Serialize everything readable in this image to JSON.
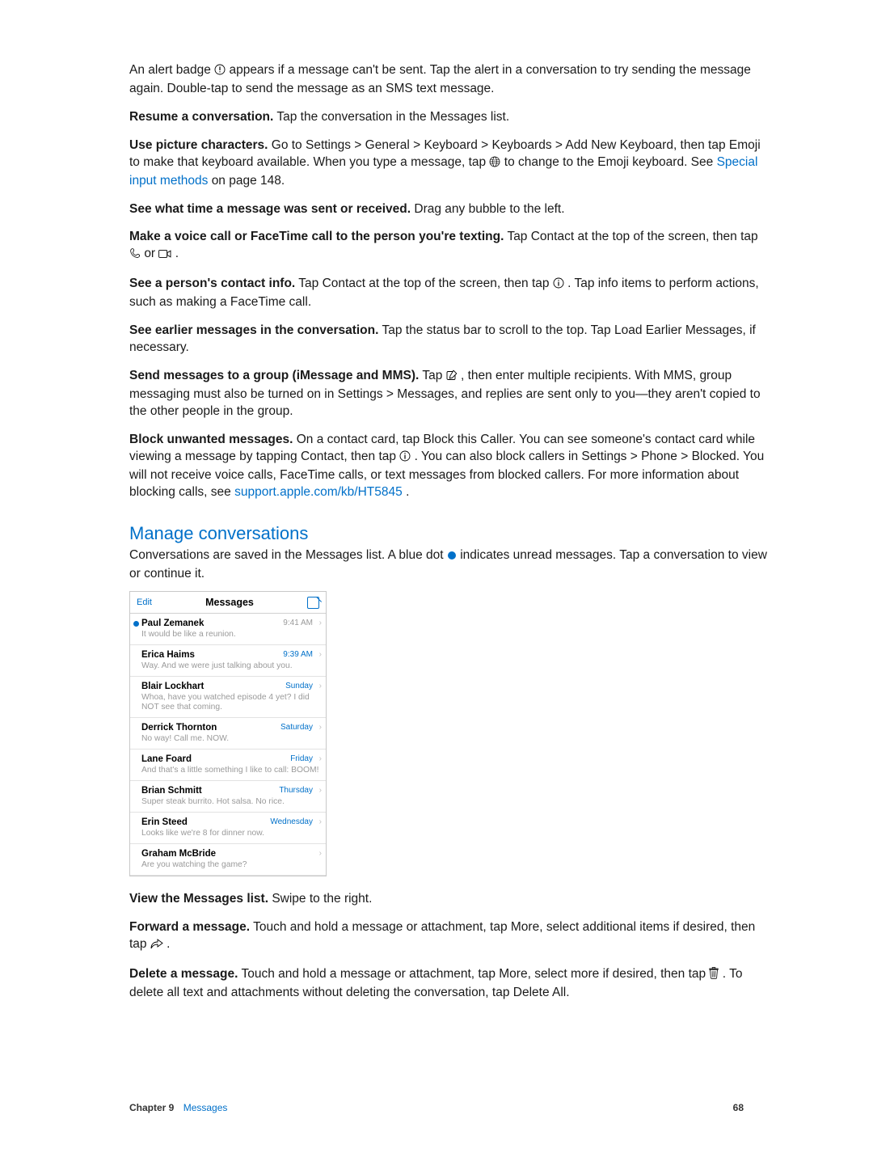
{
  "paragraphs": {
    "p1a": "An alert badge ",
    "p1b": " appears if a message can't be sent. Tap the alert in a conversation to try sending the message again. Double-tap to send the message as an SMS text message.",
    "p2_strong": "Resume a conversation.",
    "p2_rest": " Tap the conversation in the Messages list.",
    "p3_strong": "Use picture characters.",
    "p3a": " Go to Settings > General > Keyboard > Keyboards > Add New Keyboard, then tap Emoji to make that keyboard available. When you type a message, tap ",
    "p3b": " to change to the Emoji keyboard. See ",
    "p3_link": "Special input methods",
    "p3c": " on page 148.",
    "p4_strong": "See what time a message was sent or received.",
    "p4_rest": " Drag any bubble to the left.",
    "p5_strong": "Make a voice call or FaceTime call to the person you're texting.",
    "p5a": " Tap Contact at the top of the screen, then tap ",
    "p5b": " or ",
    "p5c": ".",
    "p6_strong": "See a person's contact info.",
    "p6a": " Tap Contact at the top of the screen, then tap ",
    "p6b": ". Tap info items to perform actions, such as making a FaceTime call.",
    "p7_strong": "See earlier messages in the conversation.",
    "p7_rest": " Tap the status bar to scroll to the top. Tap Load Earlier Messages, if necessary.",
    "p8_strong": "Send messages to a group (iMessage and MMS).",
    "p8a": " Tap ",
    "p8b": ", then enter multiple recipients. With MMS, group messaging must also be turned on in Settings > Messages, and replies are sent only to you—they aren't copied to the other people in the group.",
    "p9_strong": "Block unwanted messages.",
    "p9a": " On a contact card, tap Block this Caller. You can see someone's contact card while viewing a message by tapping Contact, then tap ",
    "p9b": ". You can also block callers in Settings > Phone > Blocked. You will not receive voice calls, FaceTime calls, or text messages from blocked callers. For more information about blocking calls, see ",
    "p9_link": "support.apple.com/kb/HT5845",
    "p9c": ".",
    "h2": "Manage conversations",
    "p10a": "Conversations are saved in the Messages list. A blue dot ",
    "p10b": " indicates unread messages. Tap a conversation to view or continue it.",
    "p11_strong": "View the Messages list.",
    "p11_rest": " Swipe to the right.",
    "p12_strong": "Forward a message.",
    "p12a": " Touch and hold a message or attachment, tap More, select additional items if desired, then tap ",
    "p12b": ".",
    "p13_strong": "Delete a message.",
    "p13a": " Touch and hold a message or attachment, tap More, select more if desired, then tap ",
    "p13b": ". To delete all text and attachments without deleting the conversation, tap Delete All."
  },
  "phone": {
    "edit": "Edit",
    "title": "Messages",
    "rows": [
      {
        "name": "Paul Zemanek",
        "time": "9:41 AM",
        "text": "It would be like a reunion.",
        "unread": true,
        "hl": false
      },
      {
        "name": "Erica Haims",
        "time": "9:39 AM",
        "text": "Way. And we were just talking about you.",
        "unread": false,
        "hl": true
      },
      {
        "name": "Blair Lockhart",
        "time": "Sunday",
        "text": "Whoa, have you watched episode 4 yet? I did NOT see that coming.",
        "unread": false,
        "hl": true
      },
      {
        "name": "Derrick Thornton",
        "time": "Saturday",
        "text": "No way! Call me. NOW.",
        "unread": false,
        "hl": true
      },
      {
        "name": "Lane Foard",
        "time": "Friday",
        "text": "And that's a little something I like to call: BOOM!",
        "unread": false,
        "hl": true
      },
      {
        "name": "Brian Schmitt",
        "time": "Thursday",
        "text": "Super steak burrito. Hot salsa. No rice.",
        "unread": false,
        "hl": true
      },
      {
        "name": "Erin Steed",
        "time": "Wednesday",
        "text": "Looks like we're 8 for dinner now.",
        "unread": false,
        "hl": true
      },
      {
        "name": "Graham McBride",
        "time": "",
        "text": "Are you watching the game?",
        "unread": false,
        "hl": false
      }
    ]
  },
  "footer": {
    "chapter": "Chapter  9",
    "section": "Messages",
    "page": "68"
  }
}
